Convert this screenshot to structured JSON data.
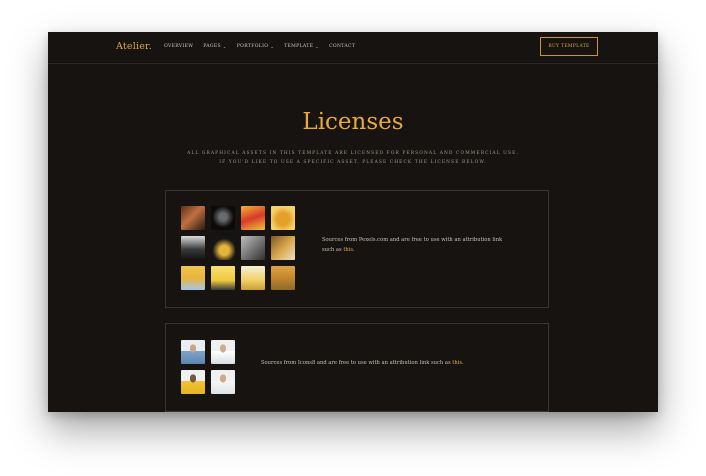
{
  "nav": {
    "logo": "Atelier.",
    "items": [
      {
        "label": "OVERVIEW",
        "dropdown": false
      },
      {
        "label": "PAGES",
        "dropdown": true
      },
      {
        "label": "PORTFOLIO",
        "dropdown": true
      },
      {
        "label": "TEMPLATE",
        "dropdown": true
      },
      {
        "label": "CONTACT",
        "dropdown": false
      }
    ],
    "cta": "BUY TEMPLATE"
  },
  "hero": {
    "title": "Licenses",
    "subtitle_line1": "ALL GRAPHICAL ASSETS IN THIS TEMPLATE ARE LICENSED FOR PERSONAL AND COMMERCIAL USE.",
    "subtitle_line2": "IF YOU'D LIKE TO USE A SPECIFIC ASSET, PLEASE CHECK THE LICENSE BELOW."
  },
  "cards": [
    {
      "text": "Sources from Pexels.com and are free to use with an attribution link such as ",
      "link": "this."
    },
    {
      "text": "Sources from Icons8 and are free to use with an attribution link such as ",
      "link": "this."
    }
  ],
  "colors": {
    "accent": "#e6ab3c",
    "background": "#161311",
    "border": "#3a3430",
    "text": "#c9c1b8"
  },
  "thumbnails": {
    "pexels": [
      "portrait-woman-orange",
      "sunglasses-dark",
      "red-gloves-yellow",
      "woman-yellow-dress",
      "laptop-workspace",
      "woman-yellow-dark",
      "phone-desk",
      "person-yellow-room",
      "woman-yellow-wall",
      "yellow-chairs",
      "yellow-room-light",
      "hay-field"
    ],
    "icons8": [
      "man-blue-shirt",
      "man-white-shirt",
      "woman-yellow-top",
      "man-sunglasses"
    ]
  }
}
